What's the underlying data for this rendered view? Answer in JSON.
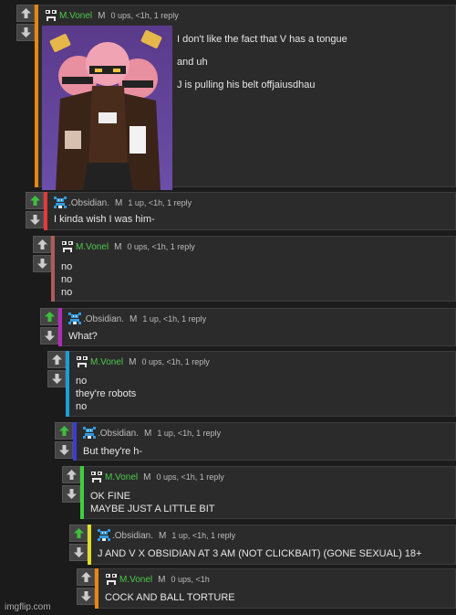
{
  "colors": {
    "upvote_active": "#3fbf3f",
    "vote_idle": "#cccccc",
    "name_vonel": "#4cc94c",
    "name_obsidian": "#bbbbbb",
    "obsidian_icon": "#3399dd",
    "card_bg": "#2b2b2b",
    "page_bg": "#1b1b1b"
  },
  "comments": [
    {
      "username": "M.Vonel",
      "mod": "M",
      "meta": "0 ups, <1h, 1 reply",
      "upvoted": false,
      "accent": "#e8860f",
      "avatar_icon": "meme-face-icon",
      "image": "anime-robots-image",
      "lines": [
        "I don't like the fact that V has a tongue",
        "and uh",
        "J is pulling his belt offjaiusdhau"
      ]
    },
    {
      "username": ".Obsidian.",
      "mod": "M",
      "meta": "1 up, <1h, 1 reply",
      "upvoted": true,
      "accent": "#e03a3a",
      "avatar_icon": "pixel-avatar-icon",
      "lines": [
        "I kinda wish I was him-"
      ]
    },
    {
      "username": "M.Vonel",
      "mod": "M",
      "meta": "0 ups, <1h, 1 reply",
      "upvoted": false,
      "accent": "#b05a5a",
      "avatar_icon": "meme-face-icon",
      "lines": [
        "no",
        "no",
        "no"
      ]
    },
    {
      "username": ".Obsidian.",
      "mod": "M",
      "meta": "1 up, <1h, 1 reply",
      "upvoted": true,
      "accent": "#b22bb8",
      "avatar_icon": "pixel-avatar-icon",
      "lines": [
        "What?"
      ]
    },
    {
      "username": "M.Vonel",
      "mod": "M",
      "meta": "0 ups, <1h, 1 reply",
      "upvoted": false,
      "accent": "#1a9fd6",
      "avatar_icon": "meme-face-icon",
      "lines": [
        "no",
        "they're robots",
        "no"
      ]
    },
    {
      "username": ".Obsidian.",
      "mod": "M",
      "meta": "1 up, <1h, 1 reply",
      "upvoted": true,
      "accent": "#3b3bd6",
      "avatar_icon": "pixel-avatar-icon",
      "lines": [
        "But they're h-"
      ]
    },
    {
      "username": "M.Vonel",
      "mod": "M",
      "meta": "0 ups, <1h, 1 reply",
      "upvoted": false,
      "accent": "#3fcf3f",
      "avatar_icon": "meme-face-icon",
      "lines": [
        "OK FINE",
        "MAYBE JUST A LITTLE BIT"
      ]
    },
    {
      "username": ".Obsidian.",
      "mod": "M",
      "meta": "1 up, <1h, 1 reply",
      "upvoted": true,
      "accent": "#dede2a",
      "avatar_icon": "pixel-avatar-icon",
      "lines": [
        "J AND V X OBSIDIAN AT 3 AM (NOT CLICKBAIT) (GONE SEXUAL) 18+"
      ]
    },
    {
      "username": "M.Vonel",
      "mod": "M",
      "meta": "0 ups, <1h",
      "upvoted": false,
      "accent": "#e8860f",
      "avatar_icon": "meme-face-icon",
      "lines": [
        "COCK AND BALL TORTURE"
      ]
    }
  ],
  "watermark": "imgflip.com"
}
